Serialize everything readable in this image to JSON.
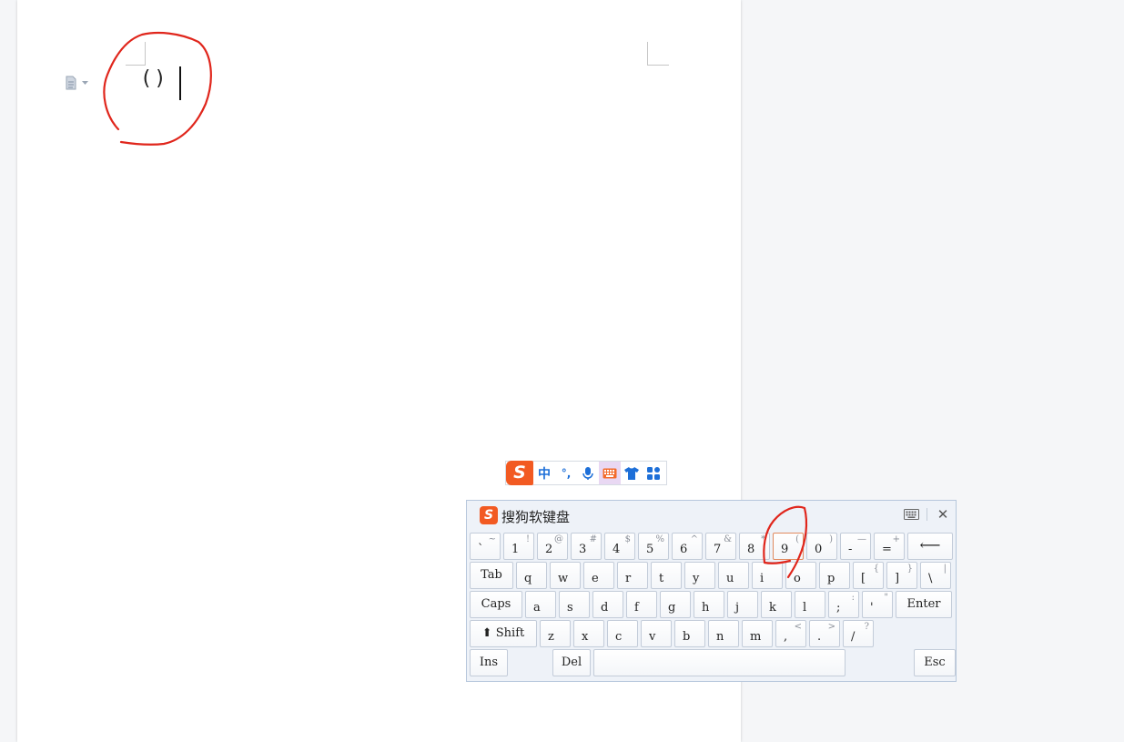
{
  "document": {
    "text": "()"
  },
  "ime_toolbar": {
    "logo": "S",
    "mode": "中",
    "punctuation": "°,",
    "items": [
      "mic-icon",
      "keyboard-icon",
      "skin-icon",
      "toolbox-icon"
    ]
  },
  "soft_keyboard": {
    "logo": "S",
    "title": "搜狗软键盘",
    "close": "✕",
    "rows": [
      [
        {
          "main": "`",
          "shift": "~"
        },
        {
          "main": "1",
          "shift": "!"
        },
        {
          "main": "2",
          "shift": "@"
        },
        {
          "main": "3",
          "shift": "#"
        },
        {
          "main": "4",
          "shift": "$"
        },
        {
          "main": "5",
          "shift": "%"
        },
        {
          "main": "6",
          "shift": "^"
        },
        {
          "main": "7",
          "shift": "&"
        },
        {
          "main": "8",
          "shift": "*"
        },
        {
          "main": "9",
          "shift": "("
        },
        {
          "main": "0",
          "shift": ")"
        },
        {
          "main": "-",
          "shift": "—"
        },
        {
          "main": "=",
          "shift": "+"
        },
        {
          "main": "⟵",
          "shift": ""
        }
      ],
      [
        {
          "main": "Tab",
          "shift": ""
        },
        {
          "main": "q",
          "shift": ""
        },
        {
          "main": "w",
          "shift": ""
        },
        {
          "main": "e",
          "shift": ""
        },
        {
          "main": "r",
          "shift": ""
        },
        {
          "main": "t",
          "shift": ""
        },
        {
          "main": "y",
          "shift": ""
        },
        {
          "main": "u",
          "shift": ""
        },
        {
          "main": "i",
          "shift": ""
        },
        {
          "main": "o",
          "shift": ""
        },
        {
          "main": "p",
          "shift": ""
        },
        {
          "main": "[",
          "shift": "{"
        },
        {
          "main": "]",
          "shift": "}"
        },
        {
          "main": "\\",
          "shift": "|"
        }
      ],
      [
        {
          "main": "Caps",
          "shift": ""
        },
        {
          "main": "a",
          "shift": ""
        },
        {
          "main": "s",
          "shift": ""
        },
        {
          "main": "d",
          "shift": ""
        },
        {
          "main": "f",
          "shift": ""
        },
        {
          "main": "g",
          "shift": ""
        },
        {
          "main": "h",
          "shift": ""
        },
        {
          "main": "j",
          "shift": ""
        },
        {
          "main": "k",
          "shift": ""
        },
        {
          "main": "l",
          "shift": ""
        },
        {
          "main": ";",
          "shift": ":"
        },
        {
          "main": "'",
          "shift": "\""
        },
        {
          "main": "Enter",
          "shift": ""
        }
      ],
      [
        {
          "main": "⬆ Shift",
          "shift": ""
        },
        {
          "main": "z",
          "shift": ""
        },
        {
          "main": "x",
          "shift": ""
        },
        {
          "main": "c",
          "shift": ""
        },
        {
          "main": "v",
          "shift": ""
        },
        {
          "main": "b",
          "shift": ""
        },
        {
          "main": "n",
          "shift": ""
        },
        {
          "main": "m",
          "shift": ""
        },
        {
          "main": ",",
          "shift": "<"
        },
        {
          "main": ".",
          "shift": ">"
        },
        {
          "main": "/",
          "shift": "?"
        }
      ],
      [
        {
          "main": "Ins",
          "shift": ""
        },
        {
          "main": "Del",
          "shift": ""
        },
        {
          "main": "",
          "shift": ""
        },
        {
          "main": "Esc",
          "shift": ""
        }
      ]
    ]
  }
}
